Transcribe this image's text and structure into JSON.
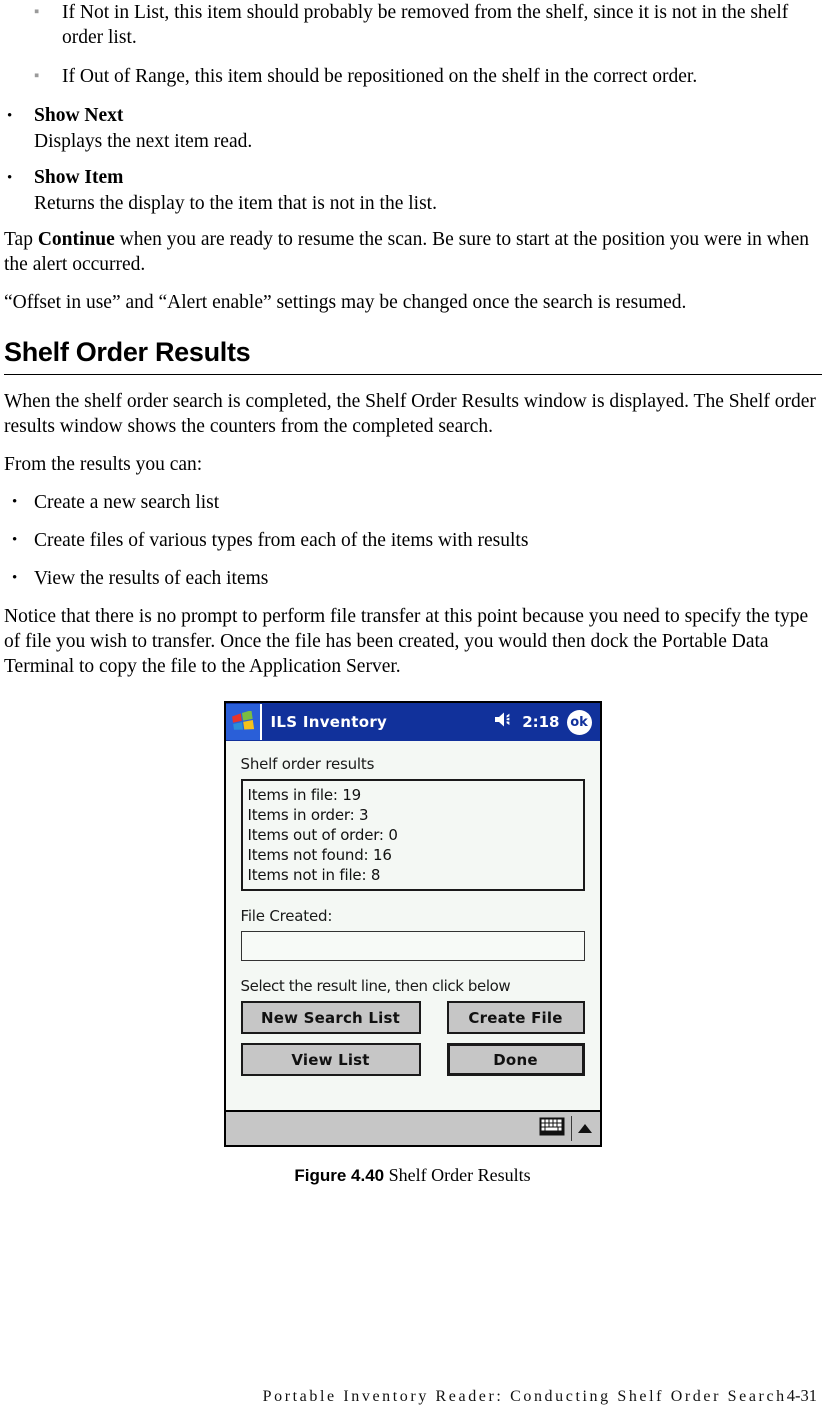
{
  "document": {
    "sub_bullets": [
      {
        "marker": "▪",
        "text": "If Not in List, this item should probably be removed from the shelf, since it is not in the shelf order list."
      },
      {
        "marker": "▪",
        "text": "If Out of Range, this item should be repositioned on the shelf in the correct order."
      }
    ],
    "terms": [
      {
        "marker": "•",
        "term": "Show Next",
        "definition": "Displays the next item read."
      },
      {
        "marker": "•",
        "term": "Show Item",
        "definition": "Returns the display to the item that is not in the list."
      }
    ],
    "paragraph_tap_pre": "Tap ",
    "paragraph_tap_bold": "Continue",
    "paragraph_tap_post": " when you are ready to resume the scan. Be sure to start at the position you were in when the alert occurred.",
    "paragraph_offset": "“Offset in use” and “Alert enable” settings may be changed once the search is resumed.",
    "section_heading": "Shelf Order Results",
    "paragraph_intro": "When the shelf order search is completed, the Shelf Order Results window is displayed. The Shelf order results window shows the counters from the completed search.",
    "paragraph_from": "From the results you can:",
    "capability_bullets": [
      {
        "marker": "•",
        "text": "Create a new search list"
      },
      {
        "marker": "•",
        "text": "Create files of various types from each of the items with results"
      },
      {
        "marker": "•",
        "text": "View the results of each items"
      }
    ],
    "paragraph_notice": "Notice that there is no prompt to perform file transfer at this point because you need to specify the type of file you wish to transfer. Once the file has been created, you would then dock the Portable Data Terminal to copy the file to the Application Server.",
    "figure_caption_number": "Figure 4.40",
    "figure_caption_text": " Shelf Order Results",
    "footer_text": "Portable Inventory Reader: Conducting Shelf Order Search",
    "footer_page": "4-31"
  },
  "pda": {
    "titlebar": {
      "app_title": "ILS Inventory",
      "clock": "2:18",
      "ok_label": "ok",
      "title_bg": "#11319b",
      "logo_bg": "#2a5fd8"
    },
    "screen_label": "Shelf order results",
    "results": [
      "Items in file: 19",
      "Items in order: 3",
      "Items out of order: 0",
      "Items not found: 16",
      "Items not in file: 8"
    ],
    "file_created_label": "File Created:",
    "file_created_value": "",
    "hint": "Select the result line, then click below",
    "buttons": [
      {
        "label": "New Search List",
        "default": false
      },
      {
        "label": "Create File",
        "default": false
      },
      {
        "label": "View List",
        "default": false
      },
      {
        "label": "Done",
        "default": true
      }
    ],
    "taskbar": {
      "keyboard_icon": "keyboard-icon",
      "arrow_icon": "up-arrow-icon"
    },
    "colors": {
      "screen_bg": "#f4f8f4",
      "button_face": "#c6c6c6",
      "taskbar": "#c6c6c6"
    }
  }
}
